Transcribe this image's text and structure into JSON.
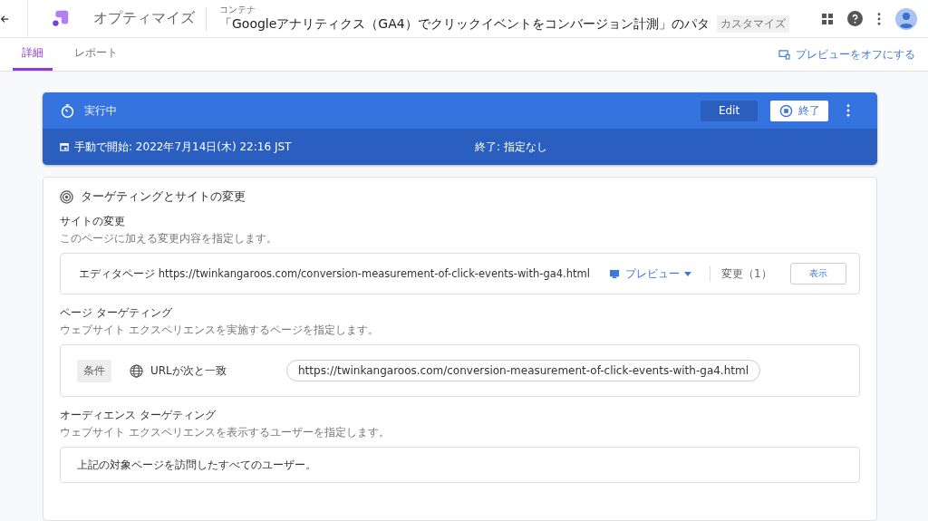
{
  "header": {
    "app_name": "オプティマイズ",
    "breadcrumb": "コンテナ",
    "title": "「Googleアナリティクス（GA4）でクリックイベントをコンバージョン計測」のパタ",
    "tag": "カスタマイズ"
  },
  "tabs": [
    {
      "label": "詳細",
      "selected": true
    },
    {
      "label": "レポート",
      "selected": false
    }
  ],
  "preview_toggle": "プレビューをオフにする",
  "status": {
    "label": "実行中",
    "edit_button": "Edit",
    "end_button": "終了",
    "start": "手動で開始: 2022年7月14日(木) 22:16 JST",
    "end": "終了: 指定なし"
  },
  "targeting": {
    "title": "ターゲティングとサイトの変更",
    "site_changes": {
      "title": "サイトの変更",
      "description": "このページに加える変更内容を指定します。",
      "editor_page": "エディタページ https://twinkangaroos.com/conversion-measurement-of-click-events-with-ga4.html",
      "preview": "プレビュー",
      "changes": "変更（1）",
      "show_button": "表示"
    },
    "page_targeting": {
      "title": "ページ ターゲティング",
      "description": "ウェブサイト エクスペリエンスを実施するページを指定します。",
      "condition_chip": "条件",
      "rule": "URLが次と一致",
      "url": "https://twinkangaroos.com/conversion-measurement-of-click-events-with-ga4.html"
    },
    "audience_targeting": {
      "title": "オーディエンス ターゲティング",
      "description": "ウェブサイト エクスペリエンスを表示するユーザーを指定します。",
      "summary": "上記の対象ページを訪問したすべてのユーザー。"
    }
  }
}
